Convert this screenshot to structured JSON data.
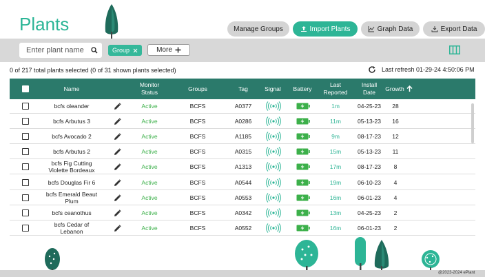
{
  "app": {
    "title": "Plants"
  },
  "header": {
    "manage_groups": "Manage Groups",
    "import_plants": "Import Plants",
    "graph_data": "Graph Data",
    "export_data": "Export Data"
  },
  "toolbar": {
    "search_placeholder": "Enter plant name",
    "filter_chip": "Group",
    "more_label": "More"
  },
  "status": {
    "selection": "0 of 217 total plants selected (0 of 31 shown plants selected)",
    "last_refresh": "Last refresh 01-29-24 4:50:06 PM"
  },
  "table": {
    "headers": {
      "name": "Name",
      "monitor_status": "Monitor Status",
      "groups": "Groups",
      "tag": "Tag",
      "signal": "Signal",
      "battery": "Battery",
      "last_reported": "Last Reported",
      "install_date": "Install Date",
      "growth": "Growth"
    },
    "rows": [
      {
        "name": "bcfs oleander",
        "status": "Active",
        "group": "BCFS",
        "tag": "A0377",
        "last": "1m",
        "date": "04-25-23",
        "growth": "28"
      },
      {
        "name": "bcfs Arbutus 3",
        "status": "Active",
        "group": "BCFS",
        "tag": "A0286",
        "last": "11m",
        "date": "05-13-23",
        "growth": "16"
      },
      {
        "name": "bcfs Avocado  2",
        "status": "Active",
        "group": "BCFS",
        "tag": "A1185",
        "last": "9m",
        "date": "08-17-23",
        "growth": "12"
      },
      {
        "name": "bcfs Arbutus 2",
        "status": "Active",
        "group": "BCFS",
        "tag": "A0315",
        "last": "15m",
        "date": "05-13-23",
        "growth": "11"
      },
      {
        "name": "bcfs Fig Cutting Violette Bordeaux",
        "status": "Active",
        "group": "BCFS",
        "tag": "A1313",
        "last": "17m",
        "date": "08-17-23",
        "growth": "8"
      },
      {
        "name": "bcfs Douglas Fir 6",
        "status": "Active",
        "group": "BCFS",
        "tag": "A0544",
        "last": "19m",
        "date": "06-10-23",
        "growth": "4"
      },
      {
        "name": "bcfs Emerald Beaut Plum",
        "status": "Active",
        "group": "BCFS",
        "tag": "A0553",
        "last": "16m",
        "date": "06-01-23",
        "growth": "4"
      },
      {
        "name": "bcfs ceanothus",
        "status": "Active",
        "group": "BCFS",
        "tag": "A0342",
        "last": "13m",
        "date": "04-25-23",
        "growth": "2"
      },
      {
        "name": "bcfs Cedar of Lebanon",
        "status": "Active",
        "group": "BCFS",
        "tag": "A0552",
        "last": "16m",
        "date": "06-01-23",
        "growth": "2"
      }
    ]
  },
  "footer": {
    "copyright": "@2023-2024 ePlant"
  },
  "colors": {
    "accent": "#2db596",
    "header_bg": "#2b7a6b",
    "active": "#3cb04a",
    "tree_dark": "#1f6b5b"
  }
}
